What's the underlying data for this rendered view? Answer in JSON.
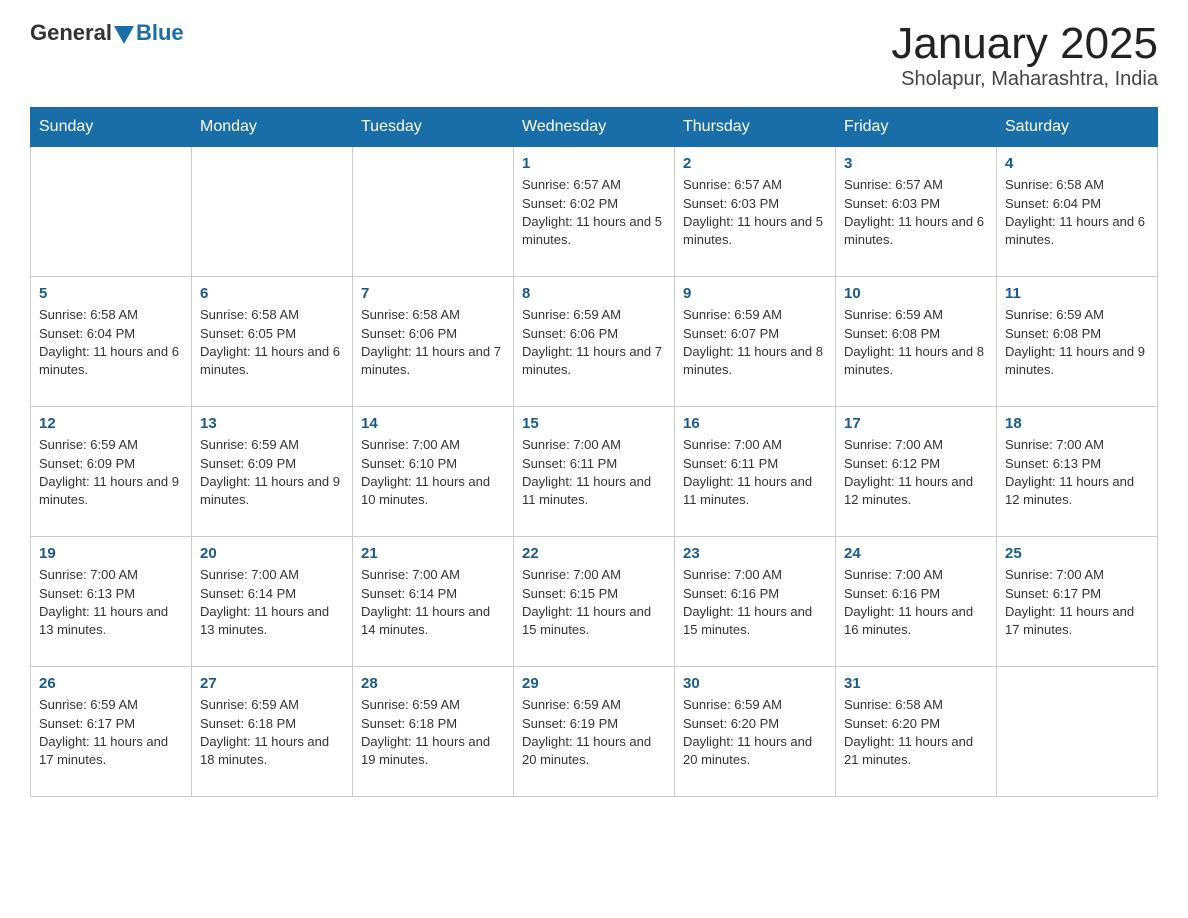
{
  "header": {
    "logo_general": "General",
    "logo_blue": "Blue",
    "title": "January 2025",
    "subtitle": "Sholapur, Maharashtra, India"
  },
  "days_of_week": [
    "Sunday",
    "Monday",
    "Tuesday",
    "Wednesday",
    "Thursday",
    "Friday",
    "Saturday"
  ],
  "weeks": [
    [
      {
        "day": "",
        "info": ""
      },
      {
        "day": "",
        "info": ""
      },
      {
        "day": "",
        "info": ""
      },
      {
        "day": "1",
        "info": "Sunrise: 6:57 AM\nSunset: 6:02 PM\nDaylight: 11 hours and 5 minutes."
      },
      {
        "day": "2",
        "info": "Sunrise: 6:57 AM\nSunset: 6:03 PM\nDaylight: 11 hours and 5 minutes."
      },
      {
        "day": "3",
        "info": "Sunrise: 6:57 AM\nSunset: 6:03 PM\nDaylight: 11 hours and 6 minutes."
      },
      {
        "day": "4",
        "info": "Sunrise: 6:58 AM\nSunset: 6:04 PM\nDaylight: 11 hours and 6 minutes."
      }
    ],
    [
      {
        "day": "5",
        "info": "Sunrise: 6:58 AM\nSunset: 6:04 PM\nDaylight: 11 hours and 6 minutes."
      },
      {
        "day": "6",
        "info": "Sunrise: 6:58 AM\nSunset: 6:05 PM\nDaylight: 11 hours and 6 minutes."
      },
      {
        "day": "7",
        "info": "Sunrise: 6:58 AM\nSunset: 6:06 PM\nDaylight: 11 hours and 7 minutes."
      },
      {
        "day": "8",
        "info": "Sunrise: 6:59 AM\nSunset: 6:06 PM\nDaylight: 11 hours and 7 minutes."
      },
      {
        "day": "9",
        "info": "Sunrise: 6:59 AM\nSunset: 6:07 PM\nDaylight: 11 hours and 8 minutes."
      },
      {
        "day": "10",
        "info": "Sunrise: 6:59 AM\nSunset: 6:08 PM\nDaylight: 11 hours and 8 minutes."
      },
      {
        "day": "11",
        "info": "Sunrise: 6:59 AM\nSunset: 6:08 PM\nDaylight: 11 hours and 9 minutes."
      }
    ],
    [
      {
        "day": "12",
        "info": "Sunrise: 6:59 AM\nSunset: 6:09 PM\nDaylight: 11 hours and 9 minutes."
      },
      {
        "day": "13",
        "info": "Sunrise: 6:59 AM\nSunset: 6:09 PM\nDaylight: 11 hours and 9 minutes."
      },
      {
        "day": "14",
        "info": "Sunrise: 7:00 AM\nSunset: 6:10 PM\nDaylight: 11 hours and 10 minutes."
      },
      {
        "day": "15",
        "info": "Sunrise: 7:00 AM\nSunset: 6:11 PM\nDaylight: 11 hours and 11 minutes."
      },
      {
        "day": "16",
        "info": "Sunrise: 7:00 AM\nSunset: 6:11 PM\nDaylight: 11 hours and 11 minutes."
      },
      {
        "day": "17",
        "info": "Sunrise: 7:00 AM\nSunset: 6:12 PM\nDaylight: 11 hours and 12 minutes."
      },
      {
        "day": "18",
        "info": "Sunrise: 7:00 AM\nSunset: 6:13 PM\nDaylight: 11 hours and 12 minutes."
      }
    ],
    [
      {
        "day": "19",
        "info": "Sunrise: 7:00 AM\nSunset: 6:13 PM\nDaylight: 11 hours and 13 minutes."
      },
      {
        "day": "20",
        "info": "Sunrise: 7:00 AM\nSunset: 6:14 PM\nDaylight: 11 hours and 13 minutes."
      },
      {
        "day": "21",
        "info": "Sunrise: 7:00 AM\nSunset: 6:14 PM\nDaylight: 11 hours and 14 minutes."
      },
      {
        "day": "22",
        "info": "Sunrise: 7:00 AM\nSunset: 6:15 PM\nDaylight: 11 hours and 15 minutes."
      },
      {
        "day": "23",
        "info": "Sunrise: 7:00 AM\nSunset: 6:16 PM\nDaylight: 11 hours and 15 minutes."
      },
      {
        "day": "24",
        "info": "Sunrise: 7:00 AM\nSunset: 6:16 PM\nDaylight: 11 hours and 16 minutes."
      },
      {
        "day": "25",
        "info": "Sunrise: 7:00 AM\nSunset: 6:17 PM\nDaylight: 11 hours and 17 minutes."
      }
    ],
    [
      {
        "day": "26",
        "info": "Sunrise: 6:59 AM\nSunset: 6:17 PM\nDaylight: 11 hours and 17 minutes."
      },
      {
        "day": "27",
        "info": "Sunrise: 6:59 AM\nSunset: 6:18 PM\nDaylight: 11 hours and 18 minutes."
      },
      {
        "day": "28",
        "info": "Sunrise: 6:59 AM\nSunset: 6:18 PM\nDaylight: 11 hours and 19 minutes."
      },
      {
        "day": "29",
        "info": "Sunrise: 6:59 AM\nSunset: 6:19 PM\nDaylight: 11 hours and 20 minutes."
      },
      {
        "day": "30",
        "info": "Sunrise: 6:59 AM\nSunset: 6:20 PM\nDaylight: 11 hours and 20 minutes."
      },
      {
        "day": "31",
        "info": "Sunrise: 6:58 AM\nSunset: 6:20 PM\nDaylight: 11 hours and 21 minutes."
      },
      {
        "day": "",
        "info": ""
      }
    ]
  ]
}
